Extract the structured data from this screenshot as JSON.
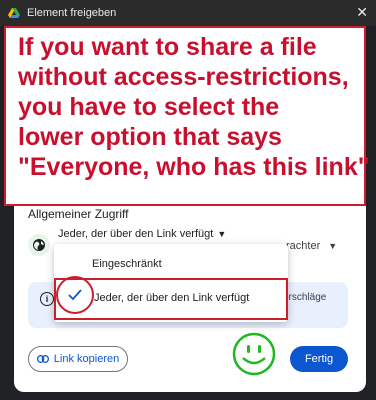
{
  "window": {
    "title": "Element freigeben"
  },
  "annotation": {
    "lines": [
      "If you want to share a file",
      "without access-restrictions,",
      "you have to select the",
      "lower option that says",
      "\"Everyone, who has this link\""
    ],
    "color": "#c8102e"
  },
  "general_access": {
    "label": "Allgemeiner Zugriff",
    "selected_option": "Jeder, der über den Link verfügt",
    "role_partial": "rachter"
  },
  "menu": {
    "options": [
      {
        "label": "Eingeschränkt",
        "selected": false
      },
      {
        "label": "Jeder, der über den Link verfügt",
        "selected": true
      }
    ]
  },
  "info_box": {
    "text_partial": "orschläge"
  },
  "footer": {
    "copy_link_label": "Link kopieren",
    "done_label": "Fertig"
  },
  "colors": {
    "primary": "#0b57d0",
    "annotation_red": "#cc1f2b",
    "smiley_green": "#1db91d"
  }
}
